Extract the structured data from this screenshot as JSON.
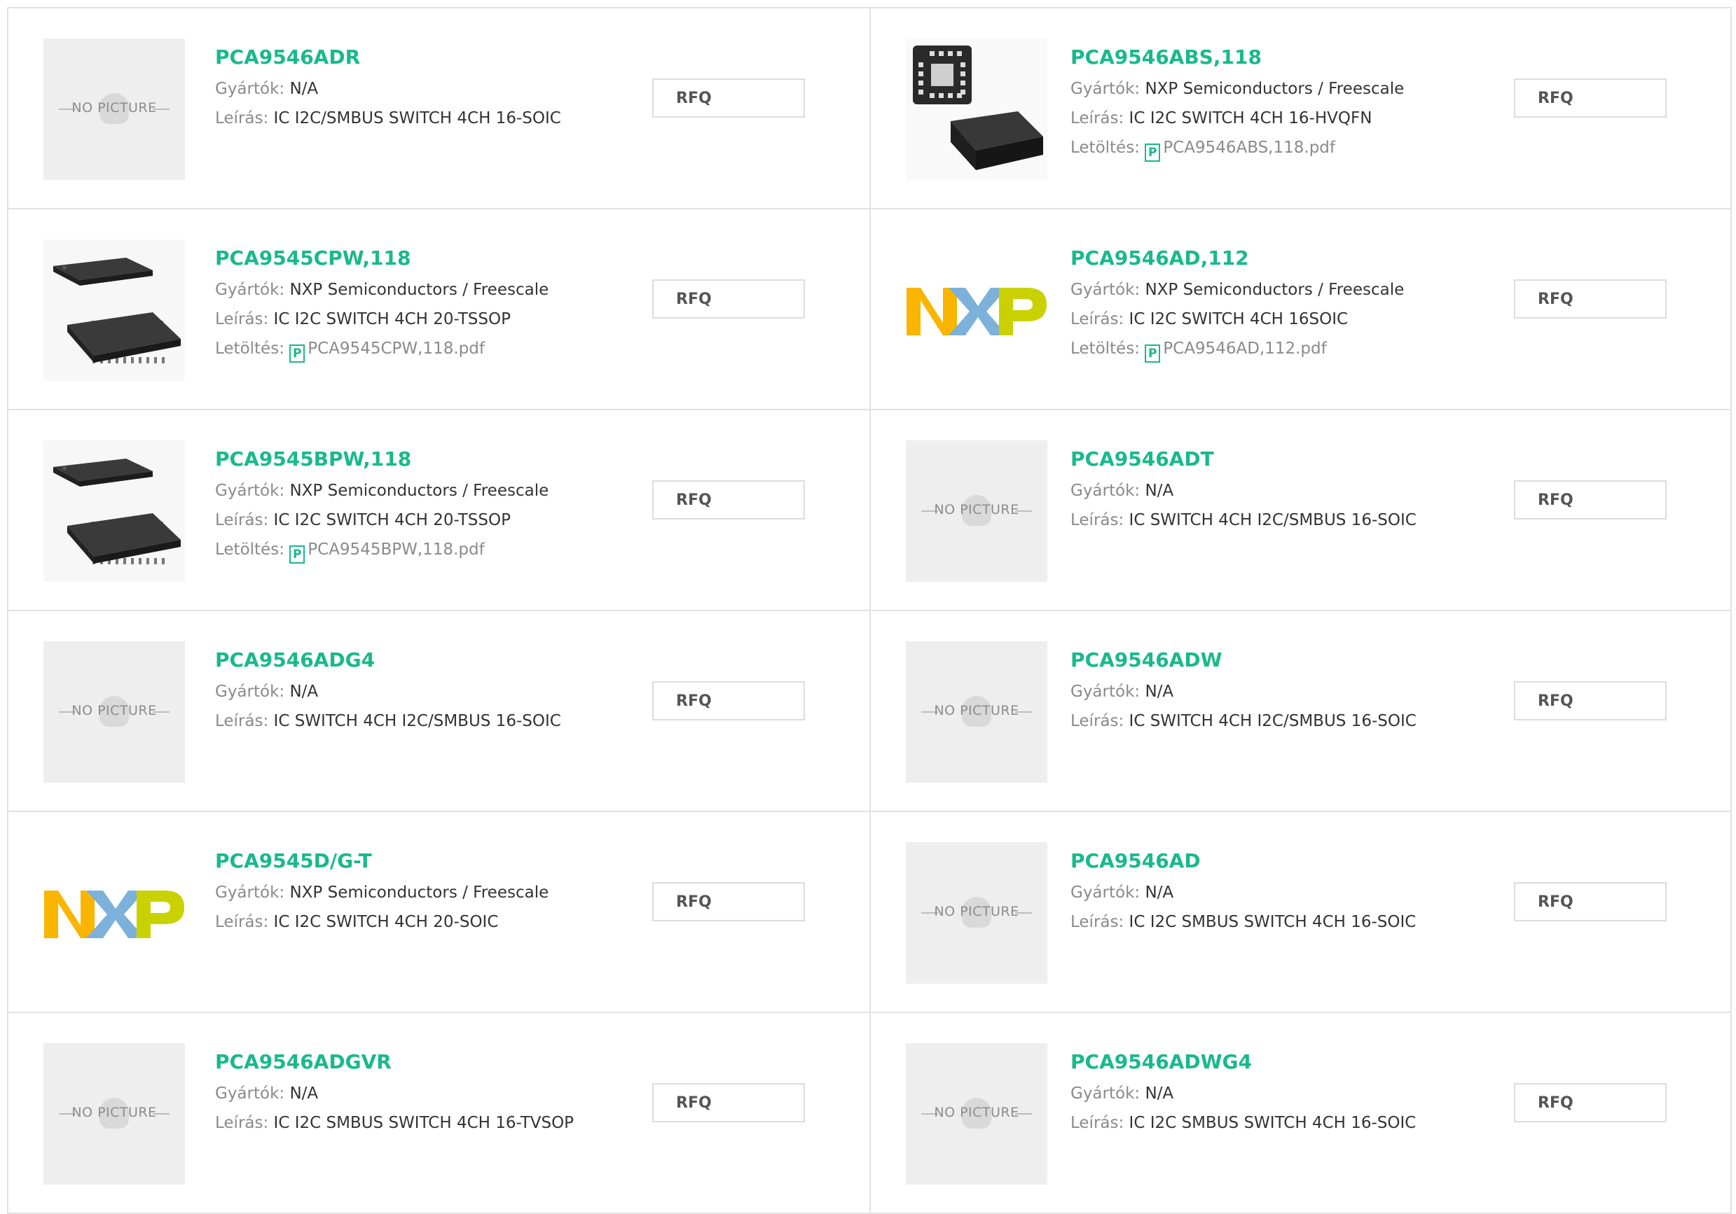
{
  "labels": {
    "manufacturer": "Gyártók:",
    "description": "Leírás:",
    "download": "Letöltés:",
    "rfq": "RFQ",
    "no_picture": "NO PICTURE",
    "pdf_glyph": "P"
  },
  "items": [
    {
      "pn": "PCA9546ADR",
      "mfr": "N/A",
      "desc": "IC I2C/SMBUS SWITCH 4CH 16-SOIC",
      "pdf": "",
      "image": "no-picture"
    },
    {
      "pn": "PCA9546ABS,118",
      "mfr": "NXP Semiconductors / Freescale",
      "desc": "IC I2C SWITCH 4CH 16-HVQFN",
      "pdf": "PCA9546ABS,118.pdf",
      "image": "qfn-chip"
    },
    {
      "pn": "PCA9545CPW,118",
      "mfr": "NXP Semiconductors / Freescale",
      "desc": "IC I2C SWITCH 4CH 20-TSSOP",
      "pdf": "PCA9545CPW,118.pdf",
      "image": "tssop-chip"
    },
    {
      "pn": "PCA9546AD,112",
      "mfr": "NXP Semiconductors / Freescale",
      "desc": "IC I2C SWITCH 4CH 16SOIC",
      "pdf": "PCA9546AD,112.pdf",
      "image": "nxp-logo"
    },
    {
      "pn": "PCA9545BPW,118",
      "mfr": "NXP Semiconductors / Freescale",
      "desc": "IC I2C SWITCH 4CH 20-TSSOP",
      "pdf": "PCA9545BPW,118.pdf",
      "image": "tssop-chip"
    },
    {
      "pn": "PCA9546ADT",
      "mfr": "N/A",
      "desc": "IC SWITCH 4CH I2C/SMBUS 16-SOIC",
      "pdf": "",
      "image": "no-picture"
    },
    {
      "pn": "PCA9546ADG4",
      "mfr": "N/A",
      "desc": "IC SWITCH 4CH I2C/SMBUS 16-SOIC",
      "pdf": "",
      "image": "no-picture"
    },
    {
      "pn": "PCA9546ADW",
      "mfr": "N/A",
      "desc": "IC SWITCH 4CH I2C/SMBUS 16-SOIC",
      "pdf": "",
      "image": "no-picture"
    },
    {
      "pn": "PCA9545D/G-T",
      "mfr": "NXP Semiconductors / Freescale",
      "desc": "IC I2C SWITCH 4CH 20-SOIC",
      "pdf": "",
      "image": "nxp-logo"
    },
    {
      "pn": "PCA9546AD",
      "mfr": "N/A",
      "desc": "IC I2C SMBUS SWITCH 4CH 16-SOIC",
      "pdf": "",
      "image": "no-picture"
    },
    {
      "pn": "PCA9546ADGVR",
      "mfr": "N/A",
      "desc": "IC I2C SMBUS SWITCH 4CH 16-TVSOP",
      "pdf": "",
      "image": "no-picture"
    },
    {
      "pn": "PCA9546ADWG4",
      "mfr": "N/A",
      "desc": "IC I2C SMBUS SWITCH 4CH 16-SOIC",
      "pdf": "",
      "image": "no-picture"
    }
  ],
  "colors": {
    "part_number": "#19b98c",
    "nxp_yellow": "#f9b500",
    "nxp_blue": "#7bb1db",
    "nxp_green": "#c9d200"
  }
}
